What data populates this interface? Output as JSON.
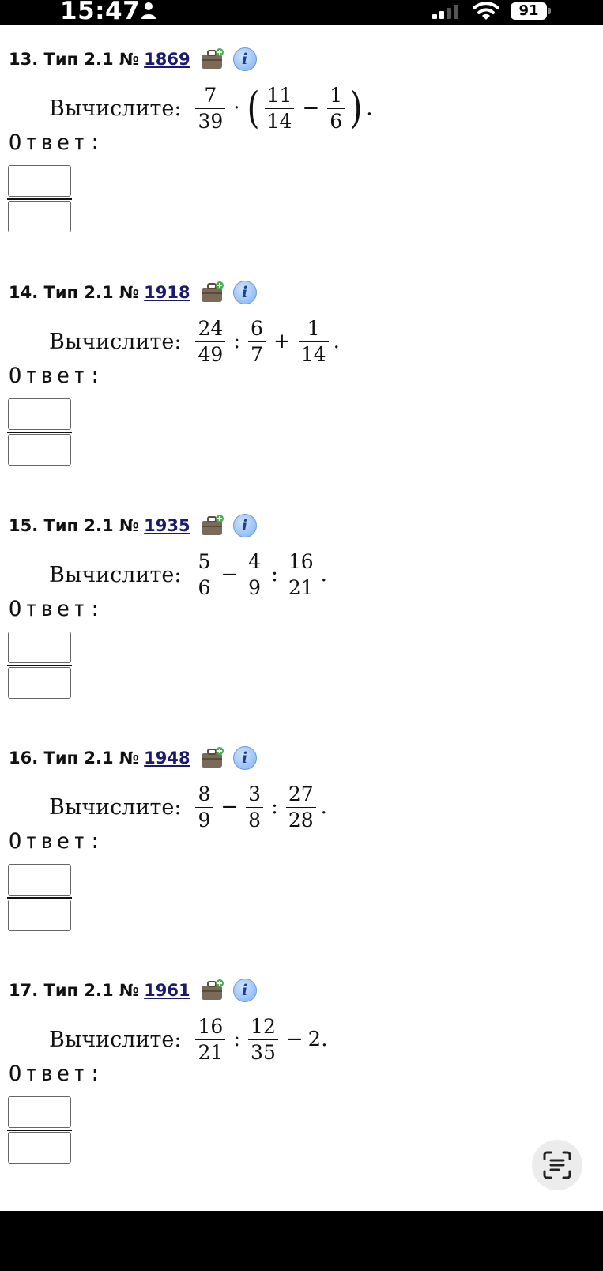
{
  "status_bar": {
    "time": "15:47",
    "battery": "91"
  },
  "problems": [
    {
      "index": "13.",
      "type": "Тип 2.1 №",
      "number": "1869",
      "task_label": "Вычислите:",
      "answer_label": "Ответ:",
      "expr": {
        "a": [
          "7",
          "39"
        ],
        "op1": "·",
        "b": [
          "11",
          "14"
        ],
        "op2": "−",
        "c": [
          "1",
          "6"
        ],
        "end": "."
      }
    },
    {
      "index": "14.",
      "type": "Тип 2.1 №",
      "number": "1918",
      "task_label": "Вычислите:",
      "answer_label": "Ответ:",
      "expr": {
        "a": [
          "24",
          "49"
        ],
        "op1": ":",
        "b": [
          "6",
          "7"
        ],
        "op2": "+",
        "c": [
          "1",
          "14"
        ],
        "end": "."
      }
    },
    {
      "index": "15.",
      "type": "Тип 2.1 №",
      "number": "1935",
      "task_label": "Вычислите:",
      "answer_label": "Ответ:",
      "expr": {
        "a": [
          "5",
          "6"
        ],
        "op1": "−",
        "b": [
          "4",
          "9"
        ],
        "op2": ":",
        "c": [
          "16",
          "21"
        ],
        "end": "."
      }
    },
    {
      "index": "16.",
      "type": "Тип 2.1 №",
      "number": "1948",
      "task_label": "Вычислите:",
      "answer_label": "Ответ:",
      "expr": {
        "a": [
          "8",
          "9"
        ],
        "op1": "−",
        "b": [
          "3",
          "8"
        ],
        "op2": ":",
        "c": [
          "27",
          "28"
        ],
        "end": "."
      }
    },
    {
      "index": "17.",
      "type": "Тип 2.1 №",
      "number": "1961",
      "task_label": "Вычислите:",
      "answer_label": "Ответ:",
      "expr": {
        "a": [
          "16",
          "21"
        ],
        "op1": ":",
        "b": [
          "12",
          "35"
        ],
        "op2": "−",
        "tail": "2",
        "end": "."
      }
    }
  ],
  "icons": {
    "briefcase": "briefcase-icon",
    "info": "info-icon",
    "scan_text": "scan-text-icon"
  }
}
